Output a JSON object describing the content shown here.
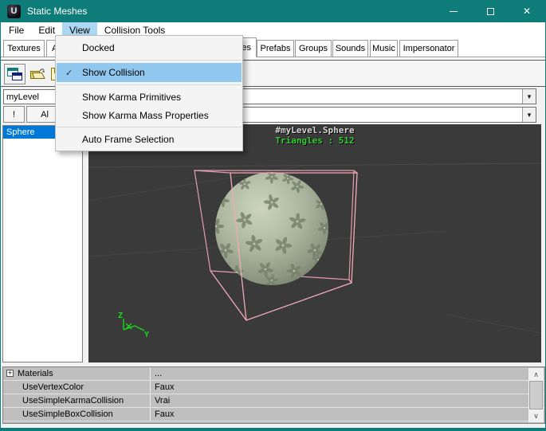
{
  "glyphs": {
    "logo": "U",
    "close": "✕",
    "check": "✓",
    "dropdown": "▼",
    "scroll_up": "∧",
    "scroll_down": "∨",
    "expand": "+"
  },
  "window": {
    "title": "Static Meshes"
  },
  "menubar": {
    "items": [
      "File",
      "Edit",
      "View",
      "Collision Tools"
    ]
  },
  "view_menu": {
    "items": [
      "Docked",
      "Show Collision",
      "Show Karma Primitives",
      "Show Karma Mass Properties",
      "Auto Frame Selection"
    ],
    "checked_item": "Show Collision"
  },
  "tabs": {
    "items": [
      "Textures",
      "A",
      "es",
      "Prefabs",
      "Groups",
      "Sounds",
      "Music",
      "Impersonator"
    ]
  },
  "package_bar": {
    "package_name": "myLevel"
  },
  "buttons": {
    "exclaim": "!",
    "all_partial": "Al"
  },
  "mesh_list": {
    "items": [
      "Sphere"
    ]
  },
  "viewport": {
    "mesh_name": "#myLevel.Sphere",
    "triangles": "Triangles : 512"
  },
  "property_grid": {
    "rows": [
      {
        "name": "Materials",
        "value": "..."
      },
      {
        "name": "UseVertexColor",
        "value": "Faux"
      },
      {
        "name": "UseSimpleKarmaCollision",
        "value": "Vrai"
      },
      {
        "name": "UseSimpleBoxCollision",
        "value": "Faux"
      }
    ]
  },
  "colors": {
    "titlebar": "#0e7c78",
    "selection": "#0078d7",
    "menu_highlight": "#8fc7ee",
    "viewport_bg": "#3a3a3a",
    "collision_pink": "#f2a9ba",
    "triangles_green": "#33cc33"
  }
}
